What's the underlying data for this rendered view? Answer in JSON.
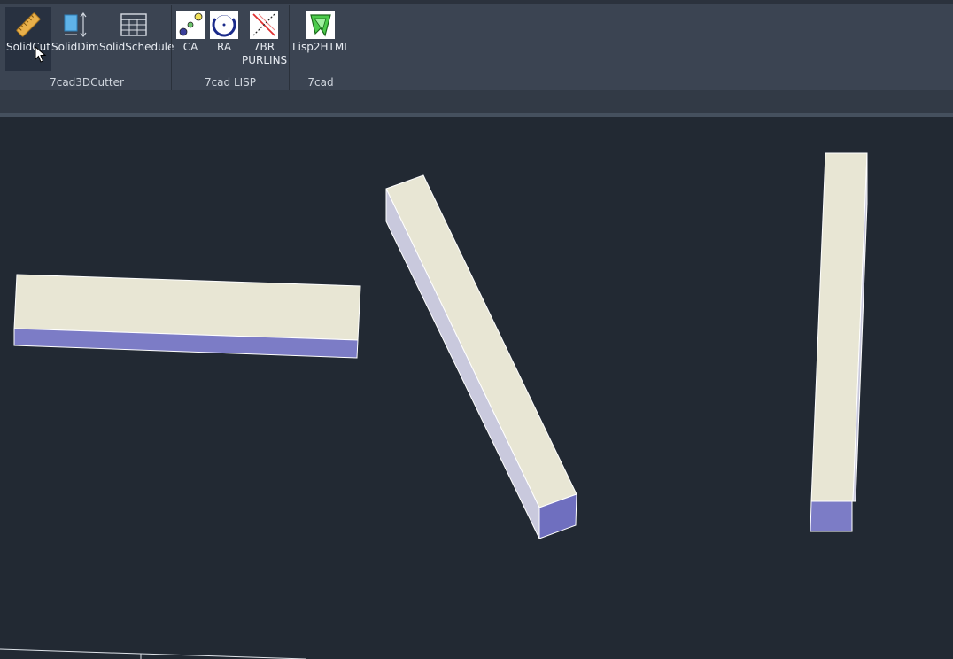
{
  "ribbon": {
    "panels": [
      {
        "title": "7cad3DCutter",
        "tools": [
          {
            "label": "SolidCut",
            "icon": "ruler-icon"
          },
          {
            "label": "SolidDim",
            "icon": "dimension-icon"
          },
          {
            "label": "SolidSchedule",
            "icon": "table-icon"
          }
        ]
      },
      {
        "title": "7cad LISP",
        "tools": [
          {
            "label": "CA",
            "icon": "circles-icon"
          },
          {
            "label": "RA",
            "icon": "ring-icon"
          },
          {
            "label_line1": "7BR",
            "label_line2": "PURLINS",
            "icon": "purlins-icon"
          }
        ]
      },
      {
        "title": "7cad",
        "tools": [
          {
            "label": "Lisp2HTML",
            "icon": "lisp2html-icon"
          }
        ]
      }
    ]
  },
  "colors": {
    "ribbon_bg": "#3b4452",
    "canvas_bg": "#222933",
    "solid_top": "#e8e6d4",
    "solid_side": "#c8c8dc",
    "solid_end": "#7a7ac4"
  }
}
